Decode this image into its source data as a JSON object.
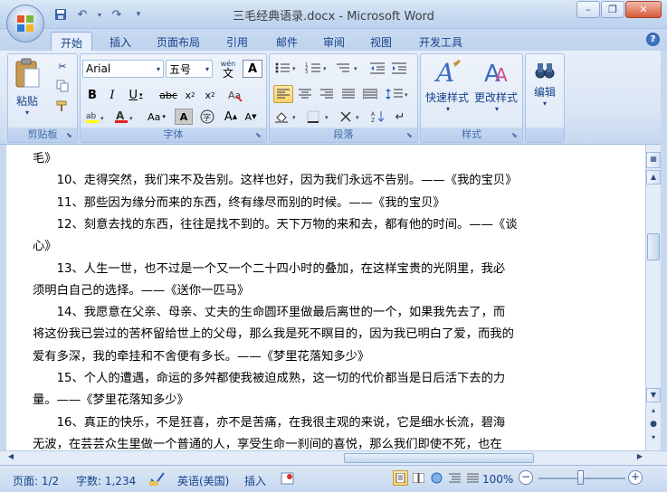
{
  "window": {
    "title": "三毛经典语录.docx - Microsoft Word"
  },
  "quick_access": {
    "icons": [
      "save-icon",
      "undo-icon",
      "redo-icon",
      "customize-icon"
    ]
  },
  "tabs": [
    {
      "label": "开始",
      "active": true
    },
    {
      "label": "插入"
    },
    {
      "label": "页面布局"
    },
    {
      "label": "引用"
    },
    {
      "label": "邮件"
    },
    {
      "label": "审阅"
    },
    {
      "label": "视图"
    },
    {
      "label": "开发工具"
    }
  ],
  "ribbon": {
    "clipboard": {
      "label": "剪贴板",
      "paste": "粘贴"
    },
    "font": {
      "label": "字体",
      "font_name": "Arial",
      "font_size": "五号",
      "wen": "wén",
      "wen_char": "文"
    },
    "paragraph": {
      "label": "段落"
    },
    "styles": {
      "label": "样式",
      "quick_styles": "快速样式",
      "change_styles": "更改样式"
    },
    "editing": {
      "label": "编辑",
      "edit": "编辑"
    }
  },
  "document": {
    "lines": [
      "毛》",
      "　　10、走得突然，我们来不及告别。这样也好，因为我们永远不告别。——《我的宝贝》",
      "　　11、那些因为缘分而来的东西，终有缘尽而别的时候。——《我的宝贝》",
      "　　12、刻意去找的东西，往往是找不到的。天下万物的来和去，都有他的时间。——《谈",
      "心》",
      "　　13、人生一世，也不过是一个又一个二十四小时的叠加，在这样宝贵的光阴里，我必",
      "须明白自己的选择。——《送你一匹马》",
      "　　14、我愿意在父亲、母亲、丈夫的生命圆环里做最后离世的一个，如果我先去了，而",
      "将这份我已尝过的苦杯留给世上的父母，那么我是死不瞑目的，因为我已明白了爱，而我的",
      "爱有多深，我的牵挂和不舍便有多长。——《梦里花落知多少》",
      "　　15、个人的遭遇，命运的多舛都使我被迫成熟，这一切的代价都当是日后活下去的力",
      "量。——《梦里花落知多少》",
      "　　16、真正的快乐，不是狂喜，亦不是苦痛，在我很主观的来说，它是细水长流，碧海",
      "无波，在芸芸众生里做一个普通的人，享受生命一刹间的喜悦，那么我们即使不死，也在"
    ]
  },
  "status": {
    "page": "页面: 1/2",
    "words": "字数: 1,234",
    "language": "英语(美国)",
    "mode": "插入",
    "zoom": "100%"
  }
}
